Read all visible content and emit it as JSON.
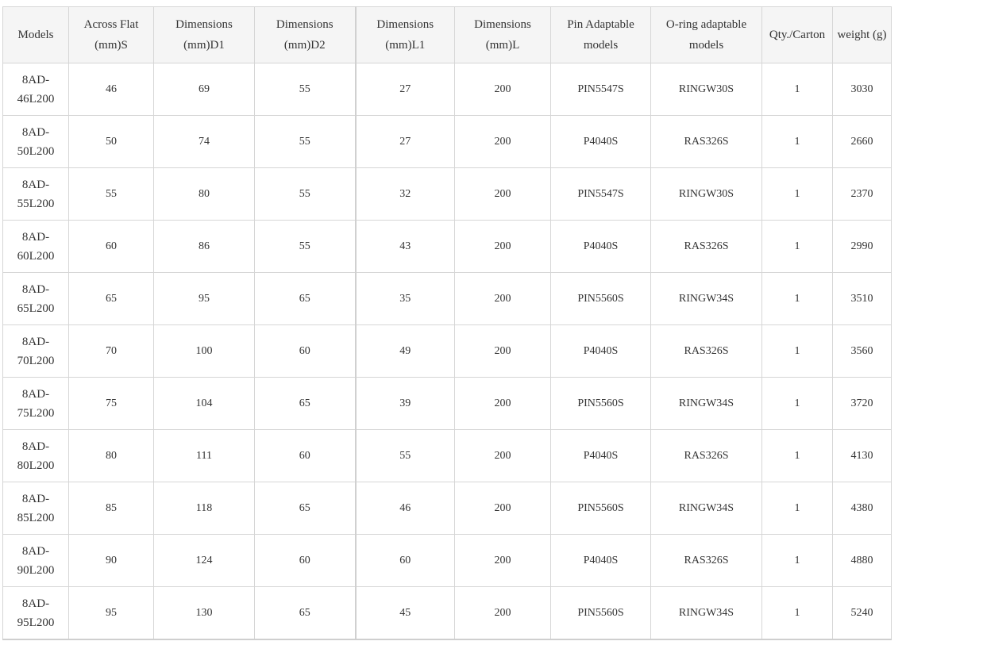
{
  "table": {
    "headers": [
      "Models",
      "Across Flat (mm)S",
      "Dimensions (mm)D1",
      "Dimensions (mm)D2",
      "Dimensions (mm)L1",
      "Dimensions (mm)L",
      "Pin Adaptable models",
      "O-ring adaptable models",
      "Qty./Carton",
      "weight (g)"
    ],
    "rows": [
      [
        "8AD-46L200",
        "46",
        "69",
        "55",
        "27",
        "200",
        "PIN5547S",
        "RINGW30S",
        "1",
        "3030"
      ],
      [
        "8AD-50L200",
        "50",
        "74",
        "55",
        "27",
        "200",
        "P4040S",
        "RAS326S",
        "1",
        "2660"
      ],
      [
        "8AD-55L200",
        "55",
        "80",
        "55",
        "32",
        "200",
        "PIN5547S",
        "RINGW30S",
        "1",
        "2370"
      ],
      [
        "8AD-60L200",
        "60",
        "86",
        "55",
        "43",
        "200",
        "P4040S",
        "RAS326S",
        "1",
        "2990"
      ],
      [
        "8AD-65L200",
        "65",
        "95",
        "65",
        "35",
        "200",
        "PIN5560S",
        "RINGW34S",
        "1",
        "3510"
      ],
      [
        "8AD-70L200",
        "70",
        "100",
        "60",
        "49",
        "200",
        "P4040S",
        "RAS326S",
        "1",
        "3560"
      ],
      [
        "8AD-75L200",
        "75",
        "104",
        "65",
        "39",
        "200",
        "PIN5560S",
        "RINGW34S",
        "1",
        "3720"
      ],
      [
        "8AD-80L200",
        "80",
        "111",
        "60",
        "55",
        "200",
        "P4040S",
        "RAS326S",
        "1",
        "4130"
      ],
      [
        "8AD-85L200",
        "85",
        "118",
        "65",
        "46",
        "200",
        "PIN5560S",
        "RINGW34S",
        "1",
        "4380"
      ],
      [
        "8AD-90L200",
        "90",
        "124",
        "60",
        "60",
        "200",
        "P4040S",
        "RAS326S",
        "1",
        "4880"
      ],
      [
        "8AD-95L200",
        "95",
        "130",
        "65",
        "45",
        "200",
        "PIN5560S",
        "RINGW34S",
        "1",
        "5240"
      ]
    ]
  }
}
